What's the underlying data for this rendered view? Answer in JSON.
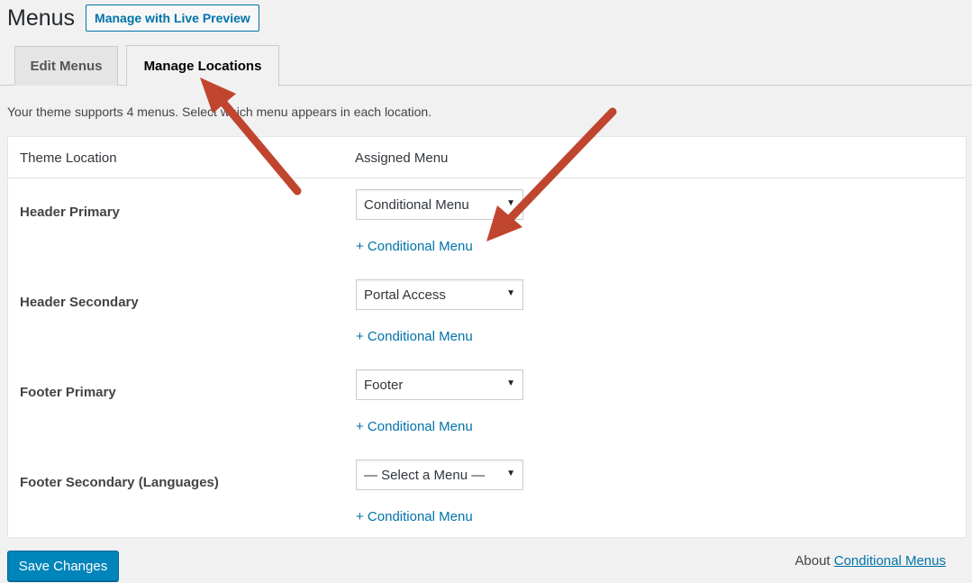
{
  "header": {
    "title": "Menus",
    "live_preview_label": "Manage with Live Preview"
  },
  "tabs": [
    {
      "label": "Edit Menus",
      "active": false
    },
    {
      "label": "Manage Locations",
      "active": true
    }
  ],
  "description": "Your theme supports 4 menus. Select which menu appears in each location.",
  "table": {
    "headers": {
      "location": "Theme Location",
      "menu": "Assigned Menu"
    },
    "rows": [
      {
        "location": "Header Primary",
        "selected": "Conditional Menu",
        "link": "+ Conditional Menu"
      },
      {
        "location": "Header Secondary",
        "selected": "Portal Access",
        "link": "+ Conditional Menu"
      },
      {
        "location": "Footer Primary",
        "selected": "Footer",
        "link": "+ Conditional Menu"
      },
      {
        "location": "Footer Secondary (Languages)",
        "selected": "— Select a Menu —",
        "link": "+ Conditional Menu"
      }
    ]
  },
  "footer": {
    "save_label": "Save Changes",
    "about_prefix": "About",
    "about_link": "Conditional Menus"
  },
  "colors": {
    "accent": "#0073aa",
    "primary_button": "#0085ba",
    "annotation_arrow": "#c0452f"
  },
  "icons": {
    "select_arrow": "dropdown-arrow-icon"
  }
}
